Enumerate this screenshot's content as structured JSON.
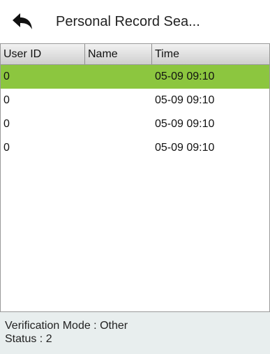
{
  "header": {
    "title": "Personal Record Sea...",
    "back_icon": "back-arrow-icon"
  },
  "table": {
    "columns": [
      "User ID",
      "Name",
      "Time"
    ],
    "rows": [
      {
        "user_id": "0",
        "name": "",
        "time": "05-09 09:10",
        "selected": true
      },
      {
        "user_id": "0",
        "name": "",
        "time": "05-09 09:10",
        "selected": false
      },
      {
        "user_id": "0",
        "name": "",
        "time": "05-09 09:10",
        "selected": false
      },
      {
        "user_id": "0",
        "name": "",
        "time": "05-09 09:10",
        "selected": false
      }
    ]
  },
  "footer": {
    "verification_mode": "Verification Mode : Other",
    "status": "Status : 2"
  },
  "colors": {
    "selected_row": "#8cc63f",
    "footer_bg": "#e8eeee"
  }
}
